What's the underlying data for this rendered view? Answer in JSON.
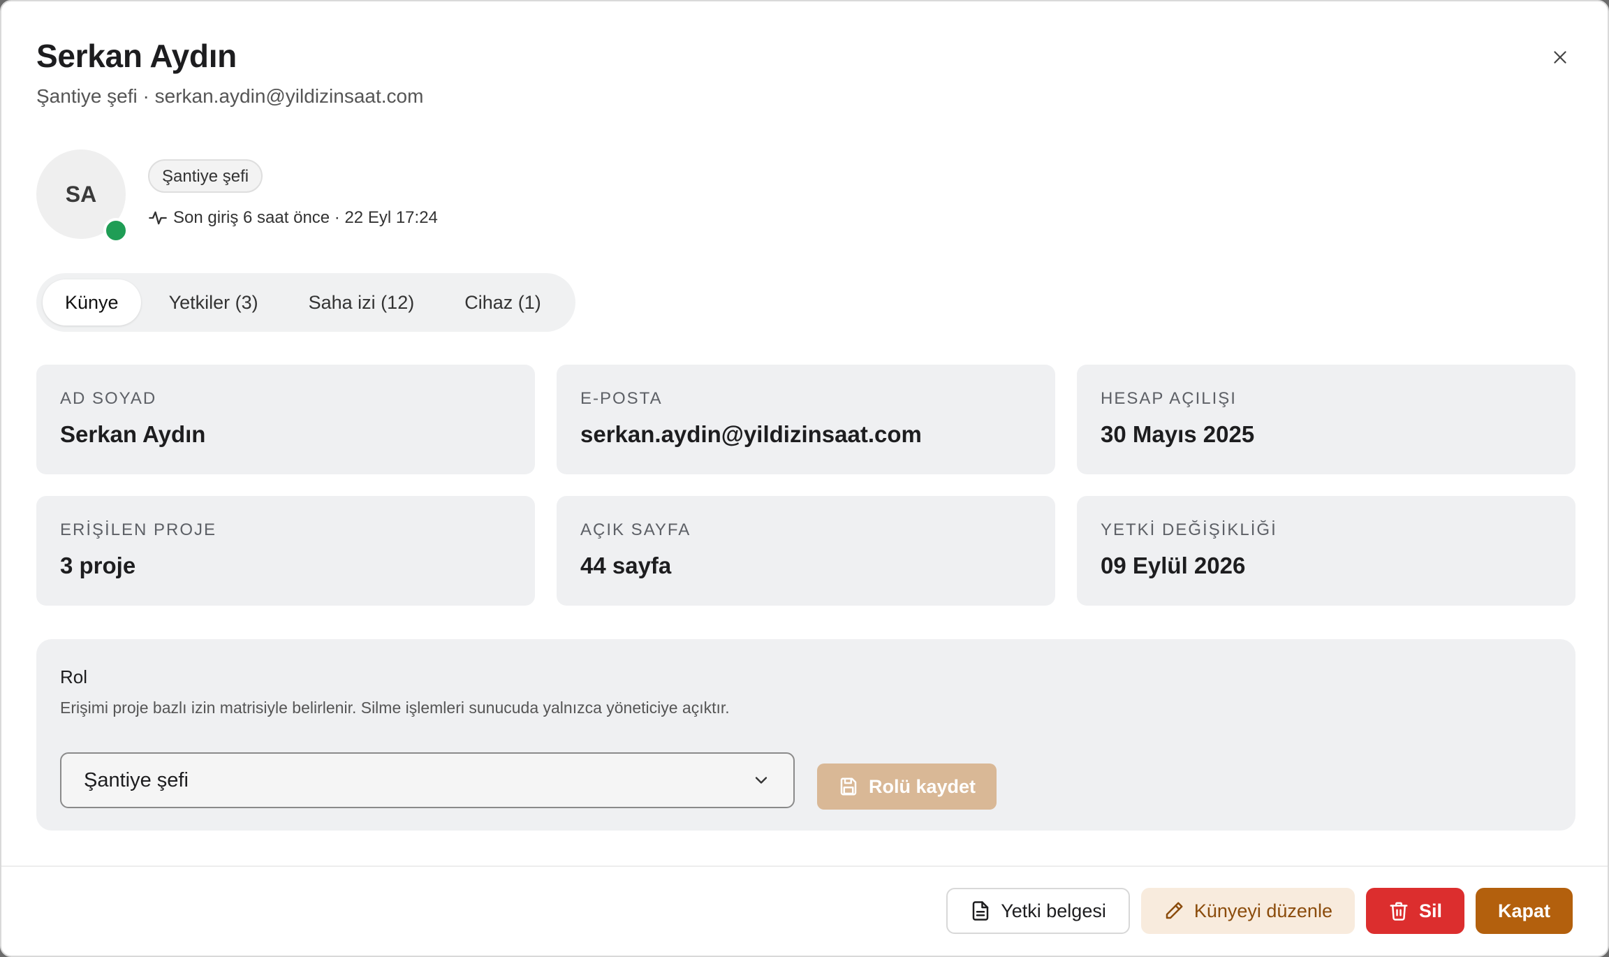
{
  "dialog": {
    "title": "Serkan Aydın",
    "subtitle": "Şantiye şefi · serkan.aydin@yildizinsaat.com",
    "close_icon": "close-icon"
  },
  "profile": {
    "initials": "SA",
    "status": "online",
    "status_color": "#1f9d55",
    "role_chip": "Şantiye şefi",
    "last_login": "Son giriş 6 saat önce · 22 Eyl 17:24"
  },
  "tabs": [
    {
      "label": "Künye",
      "active": true
    },
    {
      "label": "Yetkiler (3)",
      "active": false
    },
    {
      "label": "Saha izi (12)",
      "active": false
    },
    {
      "label": "Cihaz (1)",
      "active": false
    }
  ],
  "cards": [
    {
      "label": "AD SOYAD",
      "value": "Serkan Aydın"
    },
    {
      "label": "E-POSTA",
      "value": "serkan.aydin@yildizinsaat.com"
    },
    {
      "label": "HESAP AÇILIŞI",
      "value": "30 Mayıs 2025"
    },
    {
      "label": "ERİŞİLEN PROJE",
      "value": "3 proje"
    },
    {
      "label": "AÇIK SAYFA",
      "value": "44 sayfa"
    },
    {
      "label": "YETKİ DEĞİŞİKLİĞİ",
      "value": "09 Eylül 2026"
    }
  ],
  "role": {
    "title": "Rol",
    "description": "Erişimi proje bazlı izin matrisiyle belirlenir. Silme işlemleri sunucuda yalnızca yöneticiye açıktır.",
    "selected": "Şantiye şefi",
    "save_label": "Rolü kaydet"
  },
  "footer": {
    "permit_label": "Yetki belgesi",
    "edit_label": "Künyeyi düzenle",
    "delete_label": "Sil",
    "close_label": "Kapat"
  },
  "colors": {
    "accent": "#b3600d",
    "danger": "#dc2e2e",
    "soft_accent_bg": "#f8ebdd",
    "disabled_accent": "#d9b896"
  }
}
